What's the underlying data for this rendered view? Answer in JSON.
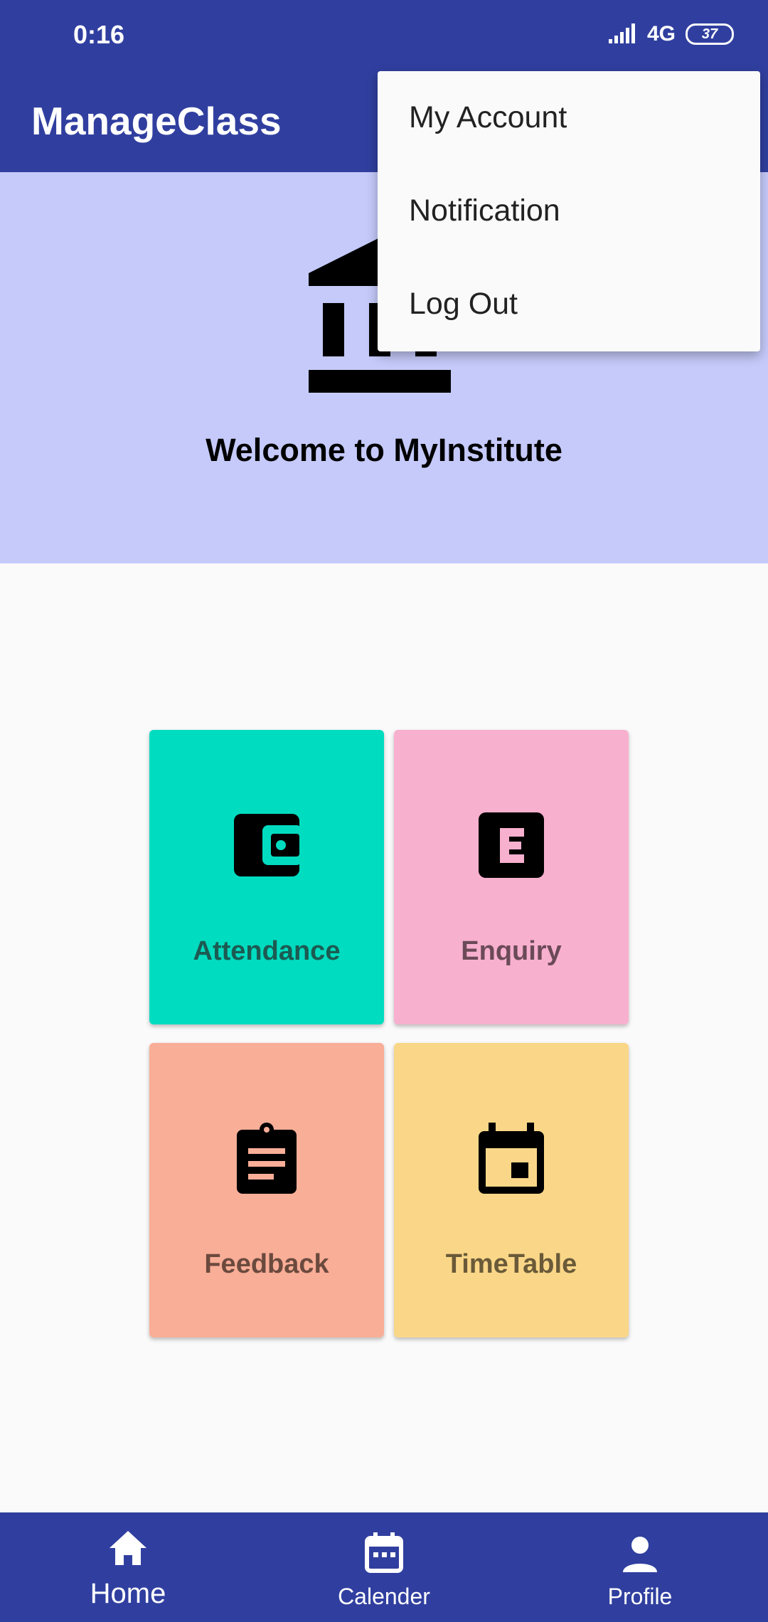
{
  "status_bar": {
    "time": "0:16",
    "network": "4G",
    "battery": "37"
  },
  "app_bar": {
    "title": "ManageClass"
  },
  "hero": {
    "title": "Welcome to MyInstitute",
    "icon": "institution-icon"
  },
  "tiles": [
    {
      "label": "Attendance",
      "icon": "wallet-icon",
      "color": "#00dcc0",
      "text_color": "#1c5b52"
    },
    {
      "label": "Enquiry",
      "icon": "e-box-icon",
      "color": "#f8b0cf",
      "text_color": "#6b4a57"
    },
    {
      "label": "Feedback",
      "icon": "clipboard-icon",
      "color": "#f9ae97",
      "text_color": "#6b4a3e"
    },
    {
      "label": "TimeTable",
      "icon": "calendar-icon",
      "color": "#fad788",
      "text_color": "#6a5a39"
    }
  ],
  "overflow_menu": {
    "items": [
      {
        "label": "My Account"
      },
      {
        "label": "Notification"
      },
      {
        "label": "Log Out"
      }
    ]
  },
  "bottom_nav": {
    "items": [
      {
        "label": "Home",
        "icon": "home-icon",
        "active": true
      },
      {
        "label": "Calender",
        "icon": "calendar-icon",
        "active": false
      },
      {
        "label": "Profile",
        "icon": "person-icon",
        "active": false
      }
    ]
  },
  "colors": {
    "primary": "#303f9f",
    "hero_bg": "#c5cafa",
    "background": "#fafafa"
  }
}
